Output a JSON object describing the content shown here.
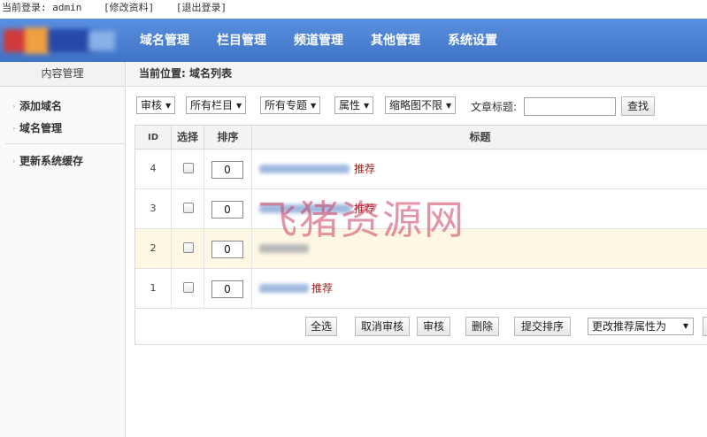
{
  "topbar": {
    "login_label": "当前登录: admin",
    "edit_profile": "[修改资料]",
    "logout": "[退出登录]"
  },
  "nav": {
    "items": [
      "域名管理",
      "栏目管理",
      "频道管理",
      "其他管理",
      "系统设置"
    ]
  },
  "sidebar": {
    "header": "内容管理",
    "items": [
      "添加域名",
      "域名管理",
      "更新系统缓存"
    ]
  },
  "breadcrumb": "当前位置: 域名列表",
  "filters": {
    "audit": "审核",
    "column": "所有栏目",
    "topic": "所有专题",
    "attribute": "属性",
    "thumbnail": "缩略图不限",
    "title_label": "文章标题:",
    "title_value": "",
    "search_button": "查找"
  },
  "table": {
    "headers": {
      "id": "ID",
      "select": "选择",
      "sort": "排序",
      "title": "标题"
    },
    "rows": [
      {
        "id": "4",
        "sort": "0",
        "tag": "推荐",
        "highlight": false
      },
      {
        "id": "3",
        "sort": "0",
        "tag": "推荐",
        "highlight": false
      },
      {
        "id": "2",
        "sort": "0",
        "tag": "",
        "highlight": true
      },
      {
        "id": "1",
        "sort": "0",
        "tag": "推荐",
        "highlight": false
      }
    ]
  },
  "actions": {
    "select_all": "全选",
    "cancel_audit": "取消审核",
    "audit": "审核",
    "delete": "删除",
    "submit_sort": "提交排序",
    "change_attr": "更改推荐属性为"
  },
  "watermark": "飞猪资源网",
  "colors": {
    "header_blue": "#4a80d4",
    "tag_red": "#a0221e",
    "row_highlight": "#fdf7e4"
  }
}
